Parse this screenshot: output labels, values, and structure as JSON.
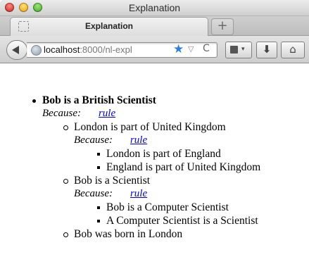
{
  "window": {
    "title": "Explanation"
  },
  "tab": {
    "label": "Explanation",
    "new_tab_label": "+"
  },
  "navbar": {
    "url_host": "localhost",
    "url_rest": ":8000/nl-expl",
    "star_glyph": "★",
    "dropdown_glyph": "▽",
    "reload_glyph": "C",
    "download_glyph": "⬇",
    "home_glyph": "⌂",
    "bookmarks_caret": "▾"
  },
  "colors": {
    "link": "#0000ee",
    "star": "#2d7fe0"
  },
  "explanation": {
    "because_label": "Because:",
    "link_label": "rule",
    "root": "Bob is a British Scientist",
    "children": [
      {
        "text": "London is part of United Kingdom",
        "children": [
          "London is part of England",
          "England is part of United Kingdom"
        ]
      },
      {
        "text": "Bob is a Scientist",
        "children": [
          "Bob is a Computer Scientist",
          "A Computer Scientist is a Scientist"
        ]
      },
      {
        "text": "Bob was born in London"
      }
    ]
  }
}
